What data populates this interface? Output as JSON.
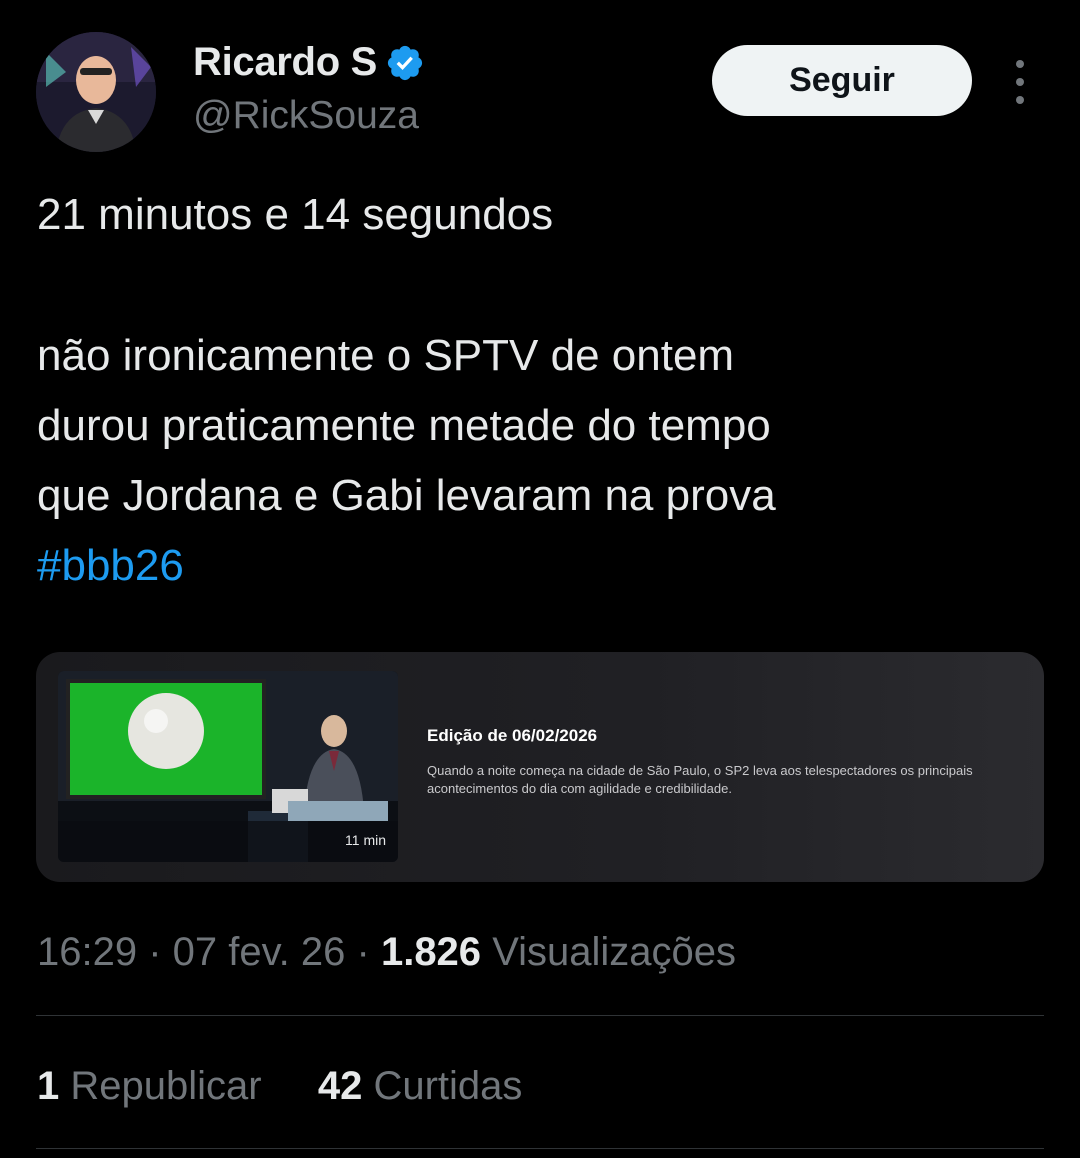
{
  "author": {
    "name": "Ricardo S",
    "handle": "@RickSouza",
    "verified": true,
    "verified_color": "#1d9bf0"
  },
  "follow_label": "Seguir",
  "tweet": {
    "line1": "21 minutos e 14 segundos",
    "line2": "não ironicamente o SPTV de ontem",
    "line3": "durou praticamente metade do tempo",
    "line4": "que Jordana e Gabi levaram na prova",
    "hashtag": "#bbb26"
  },
  "card": {
    "title": "Edição de 06/02/2026",
    "description": "Quando a noite começa na cidade de São Paulo, o SP2 leva aos telespectadores os principais acontecimentos do dia com agilidade e credibilidade.",
    "duration": "11 min"
  },
  "meta": {
    "time": "16:29",
    "date": "07 fev. 26",
    "views_count": "1.826",
    "views_label": "Visualizações"
  },
  "stats": {
    "reposts_count": "1",
    "reposts_label": "Republicar",
    "likes_count": "42",
    "likes_label": "Curtidas"
  },
  "colors": {
    "background": "#000000",
    "text": "#e7e9ea",
    "secondary": "#71767b",
    "link": "#1d9bf0"
  }
}
